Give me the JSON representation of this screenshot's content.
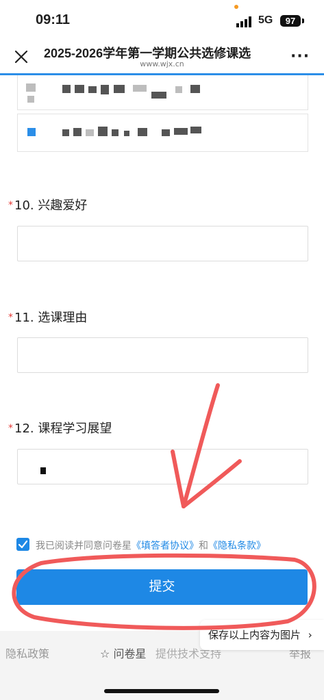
{
  "status": {
    "time": "09:11",
    "network": "5G",
    "battery": "97"
  },
  "nav": {
    "title": "2025-2026学年第一学期公共选修课选",
    "url": "www.wjx.cn",
    "more": "···"
  },
  "questions": [
    {
      "title": "10. 兴趣爱好",
      "required": "*",
      "value": ""
    },
    {
      "title": "11. 选课理由",
      "required": "*",
      "value": ""
    },
    {
      "title": "12. 课程学习展望",
      "required": "*",
      "value": ""
    }
  ],
  "agreement": {
    "text": "我已阅读并同意问卷星",
    "link1": "《填答者协议》",
    "and": "和",
    "link2": "《隐私条款》"
  },
  "submit_label": "提交",
  "footer": {
    "privacy": "隐私政策",
    "brand": "问卷星",
    "support": "提供技术支持",
    "report": "举报",
    "save_image": "保存以上内容为图片"
  },
  "colors": {
    "accent": "#1e88e5",
    "annotation": "#f05a5a",
    "required": "#e53935"
  }
}
